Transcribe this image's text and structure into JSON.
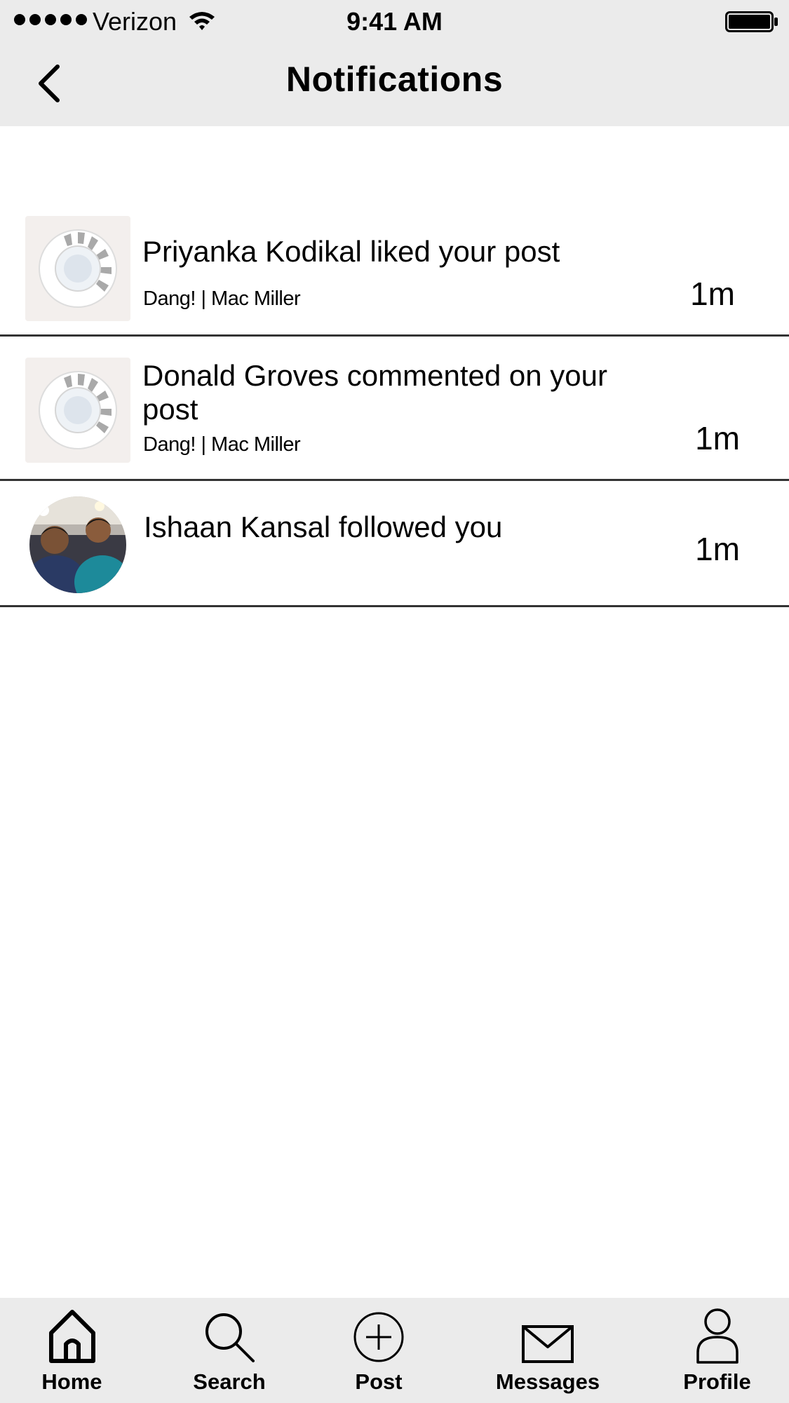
{
  "status_bar": {
    "carrier": "Verizon",
    "time": "9:41 AM"
  },
  "header": {
    "title": "Notifications"
  },
  "notifications": [
    {
      "text": "Priyanka Kodikal liked your post",
      "subtitle": "Dang! | Mac Miller",
      "time": "1m",
      "thumbnail": "album-art-icon"
    },
    {
      "text": "Donald Groves commented on your post",
      "subtitle": "Dang! | Mac Miller",
      "time": "1m",
      "thumbnail": "album-art-icon"
    },
    {
      "text": "Ishaan Kansal followed you",
      "time": "1m",
      "thumbnail": "user-avatar"
    }
  ],
  "tab_bar": {
    "items": [
      {
        "label": "Home",
        "icon": "home-icon"
      },
      {
        "label": "Search",
        "icon": "search-icon"
      },
      {
        "label": "Post",
        "icon": "plus-circle-icon"
      },
      {
        "label": "Messages",
        "icon": "envelope-icon"
      },
      {
        "label": "Profile",
        "icon": "person-icon"
      }
    ]
  },
  "colors": {
    "bar_background": "#ebebeb",
    "divider": "#333333",
    "thumbnail_background": "#f3efed"
  }
}
